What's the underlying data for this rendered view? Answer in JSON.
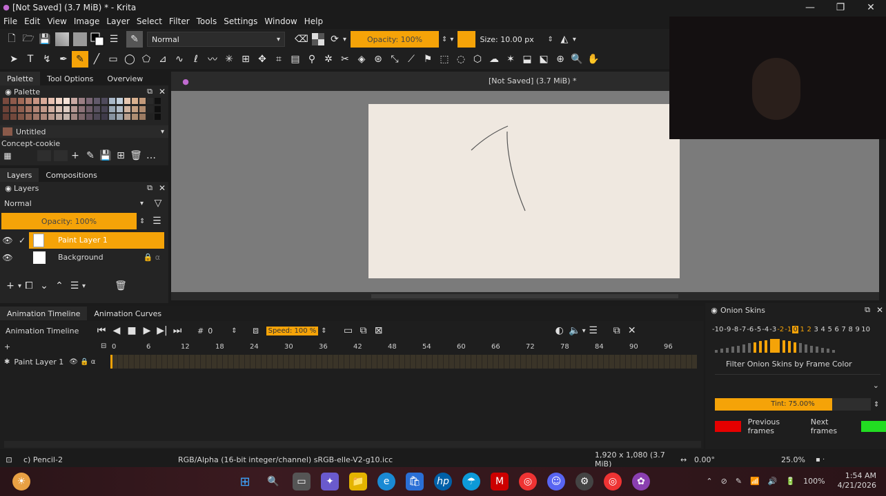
{
  "window": {
    "title": "[Not Saved]  (3.7 MiB) * - Krita"
  },
  "menu": [
    "File",
    "Edit",
    "View",
    "Image",
    "Layer",
    "Select",
    "Filter",
    "Tools",
    "Settings",
    "Window",
    "Help"
  ],
  "toolbar": {
    "blend_mode": "Normal",
    "opacity_label": "Opacity: 100%",
    "size_label": "Size: 10.00 px",
    "accent": "#f5a308"
  },
  "dock_tabs": [
    "Palette",
    "Tool Options",
    "Overview"
  ],
  "palette": {
    "title": "Palette",
    "palette_name": "Untitled",
    "concept_label": "Concept-cookie"
  },
  "layers_tabs": [
    "Layers",
    "Compositions"
  ],
  "layers": {
    "title": "Layers",
    "blend_mode": "Normal",
    "opacity_label": "Opacity:  100%",
    "items": [
      {
        "name": "Paint Layer 1",
        "active": true
      },
      {
        "name": "Background",
        "active": false
      }
    ]
  },
  "canvas": {
    "title": "[Not Saved]  (3.7 MiB) *",
    "paper_color": "#efe8e0",
    "bg_color": "#7a7a7a"
  },
  "timeline": {
    "tabs": [
      "Animation Timeline",
      "Animation Curves"
    ],
    "title": "Animation Timeline",
    "frame_value": "0",
    "speed_label": "Speed: 100 %",
    "frames": [
      "0",
      "6",
      "12",
      "18",
      "24",
      "30",
      "36",
      "42",
      "48",
      "54",
      "60",
      "66",
      "72",
      "78",
      "84",
      "90",
      "96"
    ],
    "layer_name": "Paint Layer 1"
  },
  "onion": {
    "title": "Onion Skins",
    "numbers": [
      "-10",
      "-9",
      "-8",
      "-7",
      "-6",
      "-5",
      "-4",
      "-3",
      "-2",
      "-1",
      "0",
      "1",
      "2",
      "3",
      "4",
      "5",
      "6",
      "7",
      "8",
      "9",
      "10"
    ],
    "filter_label": "Filter Onion Skins by Frame Color",
    "tint_label": "Tint: 75.00%",
    "tint_fraction": 0.75,
    "previous_label": "Previous frames",
    "next_label": "Next frames",
    "previous_color": "#e60000",
    "next_color": "#22dd22"
  },
  "status": {
    "brush": "c) Pencil-2",
    "color_space": "RGB/Alpha (16-bit integer/channel)  sRGB-elle-V2-g10.icc",
    "image_size": "1,920 x 1,080 (3.7 MiB)",
    "rotation": "0.00°",
    "zoom": "25.0%"
  },
  "taskbar": {
    "battery": "100%",
    "time": "1:54 AM",
    "date": "4/21/2026"
  }
}
